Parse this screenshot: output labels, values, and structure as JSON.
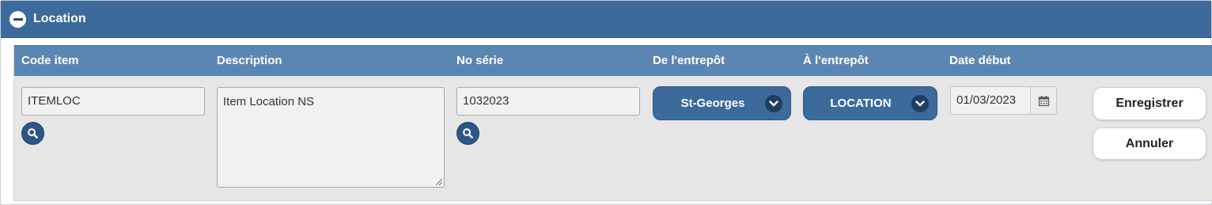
{
  "panel": {
    "title": "Location"
  },
  "columns": {
    "code_item": "Code item",
    "description": "Description",
    "no_serie": "No série",
    "de_entrepot": "De l'entrepôt",
    "a_entrepot": "À l'entrepôt",
    "date_debut": "Date début"
  },
  "row": {
    "code_item": "ITEMLOC",
    "description": "Item Location NS",
    "no_serie": "1032023",
    "de_entrepot": "St-Georges",
    "a_entrepot": "LOCATION",
    "date_debut": "01/03/2023"
  },
  "buttons": {
    "save": "Enregistrer",
    "cancel": "Annuler"
  },
  "icons": {
    "collapse": "minus-circle-icon",
    "search": "search-icon",
    "dropdown": "chevron-down-icon",
    "calendar": "calendar-icon"
  },
  "colors": {
    "header": "#3b6a9b",
    "grid_header": "#5b86b3",
    "dark_button": "#2c5686",
    "row_bg": "#e6e6e6"
  }
}
